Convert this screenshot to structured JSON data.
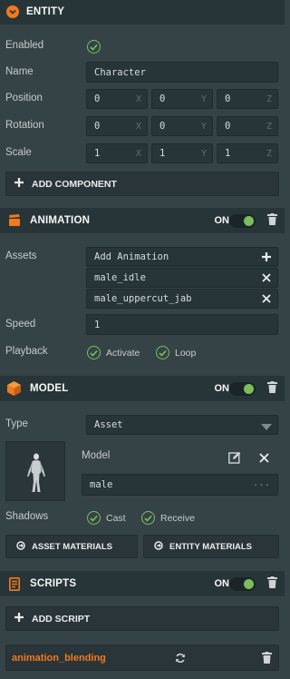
{
  "entity": {
    "title": "ENTITY",
    "enabled_label": "Enabled",
    "name_label": "Name",
    "name_value": "Character",
    "position_label": "Position",
    "rotation_label": "Rotation",
    "scale_label": "Scale",
    "position": [
      "0",
      "0",
      "0"
    ],
    "rotation": [
      "0",
      "0",
      "0"
    ],
    "scale": [
      "1",
      "1",
      "1"
    ],
    "axes": [
      "X",
      "Y",
      "Z"
    ],
    "add_component_label": "ADD COMPONENT"
  },
  "animation": {
    "title": "ANIMATION",
    "on_label": "ON",
    "assets_label": "Assets",
    "add_animation_label": "Add Animation",
    "assets": [
      "male_idle",
      "male_uppercut_jab"
    ],
    "speed_label": "Speed",
    "speed_value": "1",
    "playback_label": "Playback",
    "activate_label": "Activate",
    "loop_label": "Loop"
  },
  "model": {
    "title": "MODEL",
    "on_label": "ON",
    "type_label": "Type",
    "type_value": "Asset",
    "model_label": "Model",
    "model_value": "male",
    "more_label": "...",
    "shadows_label": "Shadows",
    "cast_label": "Cast",
    "receive_label": "Receive",
    "asset_materials_label": "ASSET MATERIALS",
    "entity_materials_label": "ENTITY MATERIALS"
  },
  "scripts": {
    "title": "SCRIPTS",
    "on_label": "ON",
    "add_script_label": "ADD SCRIPT",
    "script_name": "animation_blending"
  },
  "colors": {
    "accent_orange": "#f07a1e",
    "toggle_green": "#7cbd5e",
    "panel_bg": "#364346",
    "header_bg": "#283538"
  },
  "icons": {
    "entity": "chevron-circle-icon",
    "animation": "animation-clapper-icon",
    "model": "cube-icon",
    "scripts": "script-document-icon",
    "delete": "trash-icon",
    "add": "plus-icon",
    "remove": "close-icon",
    "edit": "edit-icon",
    "refresh": "refresh-icon",
    "target": "target-icon"
  }
}
